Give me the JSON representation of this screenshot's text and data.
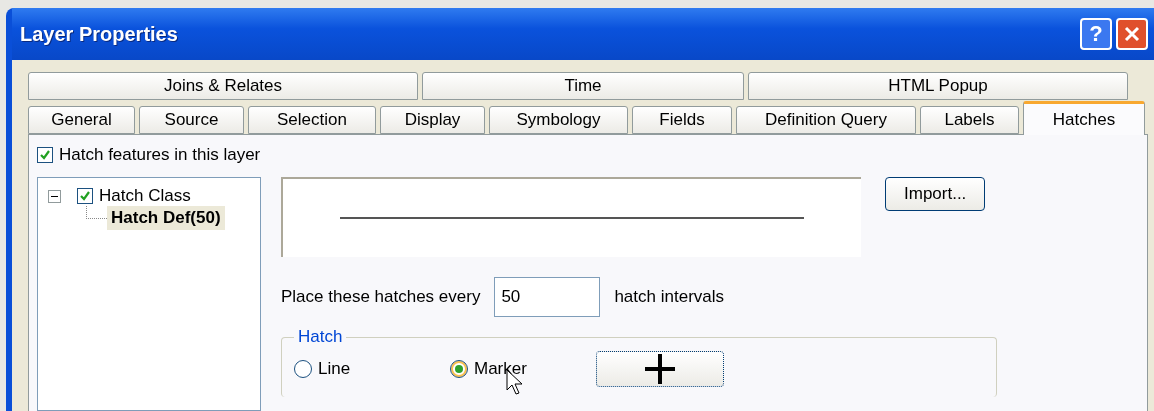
{
  "window": {
    "title": "Layer Properties",
    "help_button": "?"
  },
  "tab_rows": [
    [
      {
        "label": "Joins & Relates",
        "selected": false
      },
      {
        "label": "Time",
        "selected": false
      },
      {
        "label": "HTML Popup",
        "selected": false
      }
    ],
    [
      {
        "label": "General",
        "selected": false
      },
      {
        "label": "Source",
        "selected": false
      },
      {
        "label": "Selection",
        "selected": false
      },
      {
        "label": "Display",
        "selected": false
      },
      {
        "label": "Symbology",
        "selected": false
      },
      {
        "label": "Fields",
        "selected": false
      },
      {
        "label": "Definition Query",
        "selected": false
      },
      {
        "label": "Labels",
        "selected": false
      },
      {
        "label": "Hatches",
        "selected": true
      }
    ]
  ],
  "hatch_features": {
    "label": "Hatch features in this layer",
    "checked": true
  },
  "tree": [
    {
      "label": "Hatch Class",
      "expanded": true,
      "checked": true,
      "children": [
        {
          "label": "Hatch Def(50)",
          "selected": true
        }
      ]
    }
  ],
  "import_button": "Import...",
  "interval": {
    "label": "Place these hatches every",
    "value": "50",
    "unit": "hatch intervals"
  },
  "hatch_group": {
    "title": "Hatch",
    "options": [
      {
        "label": "Line",
        "selected": false
      },
      {
        "label": "Marker",
        "selected": true
      }
    ]
  }
}
